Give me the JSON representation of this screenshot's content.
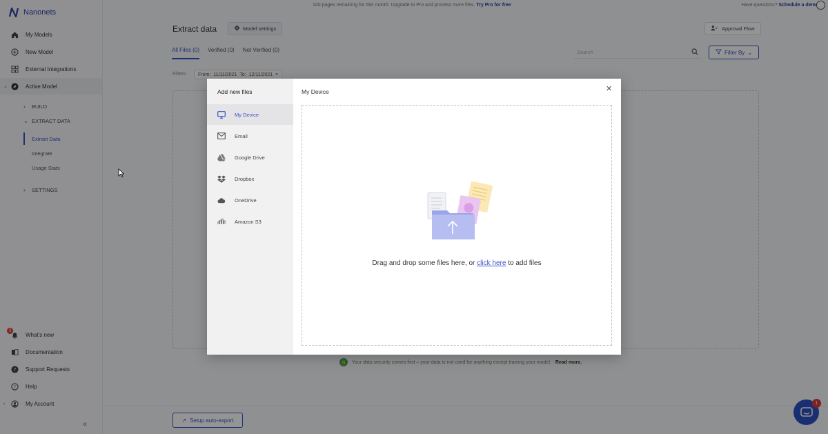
{
  "brand": {
    "name": "Nanonets",
    "color": "#2c3fa8"
  },
  "banner": {
    "text": "100 pages remaining for this month. Upgrade to Pro and process more files.",
    "link": "Try Pro for free",
    "right_text": "Have questions?",
    "right_link": "Schedule a demo"
  },
  "sidebar": {
    "items": [
      {
        "label": "My Models",
        "icon": "home-icon"
      },
      {
        "label": "New Model",
        "icon": "plus-circle-icon"
      },
      {
        "label": "External Integrations",
        "icon": "grid-icon"
      },
      {
        "label": "Active Model",
        "icon": "compass-icon"
      }
    ],
    "groups": {
      "build": "BUILD",
      "extract": "EXTRACT DATA",
      "settings": "SETTINGS"
    },
    "extract_items": [
      "Extract Data",
      "Integrate",
      "Usage Stats"
    ],
    "bottom_items": [
      {
        "label": "What's new",
        "icon": "bell-icon",
        "badge": "3"
      },
      {
        "label": "Documentation",
        "icon": "book-icon"
      },
      {
        "label": "Support Requests",
        "icon": "question-icon"
      },
      {
        "label": "Help",
        "icon": "help-icon"
      },
      {
        "label": "My Account",
        "icon": "account-icon"
      }
    ]
  },
  "main": {
    "title": "Extract data",
    "model_settings": "Model settings",
    "approval_flow": "Approval Flow",
    "tabs": [
      "All Files (0)",
      "Verified (0)",
      "Not Verified (0)"
    ],
    "search_placeholder": "Search",
    "filter_by": "Filter By",
    "filters_label": "Filters:",
    "filter_from_label": "From:",
    "filter_from": "11/11/2021",
    "filter_to_label": "To:",
    "filter_to": "12/11/2021",
    "security_text": "Your data security comes first – your data is not used for anything except training your model.",
    "security_link": "Read more.",
    "auto_export": "Setup auto-export",
    "chat_badge": "1"
  },
  "modal": {
    "left_title": "Add new files",
    "sources": [
      {
        "label": "My Device",
        "icon": "monitor-icon"
      },
      {
        "label": "Email",
        "icon": "mail-icon"
      },
      {
        "label": "Google Drive",
        "icon": "google-drive-icon"
      },
      {
        "label": "Dropbox",
        "icon": "dropbox-icon"
      },
      {
        "label": "OneDrive",
        "icon": "onedrive-icon"
      },
      {
        "label": "Amazon S3",
        "icon": "amazon-s3-icon"
      }
    ],
    "title": "My Device",
    "drop_text_before": "Drag and drop some files here, or ",
    "drop_link": "click here",
    "drop_text_after": " to add files"
  },
  "colors": {
    "accent": "#3b52c4",
    "overlay": "rgba(0,0,0,0.42)"
  }
}
